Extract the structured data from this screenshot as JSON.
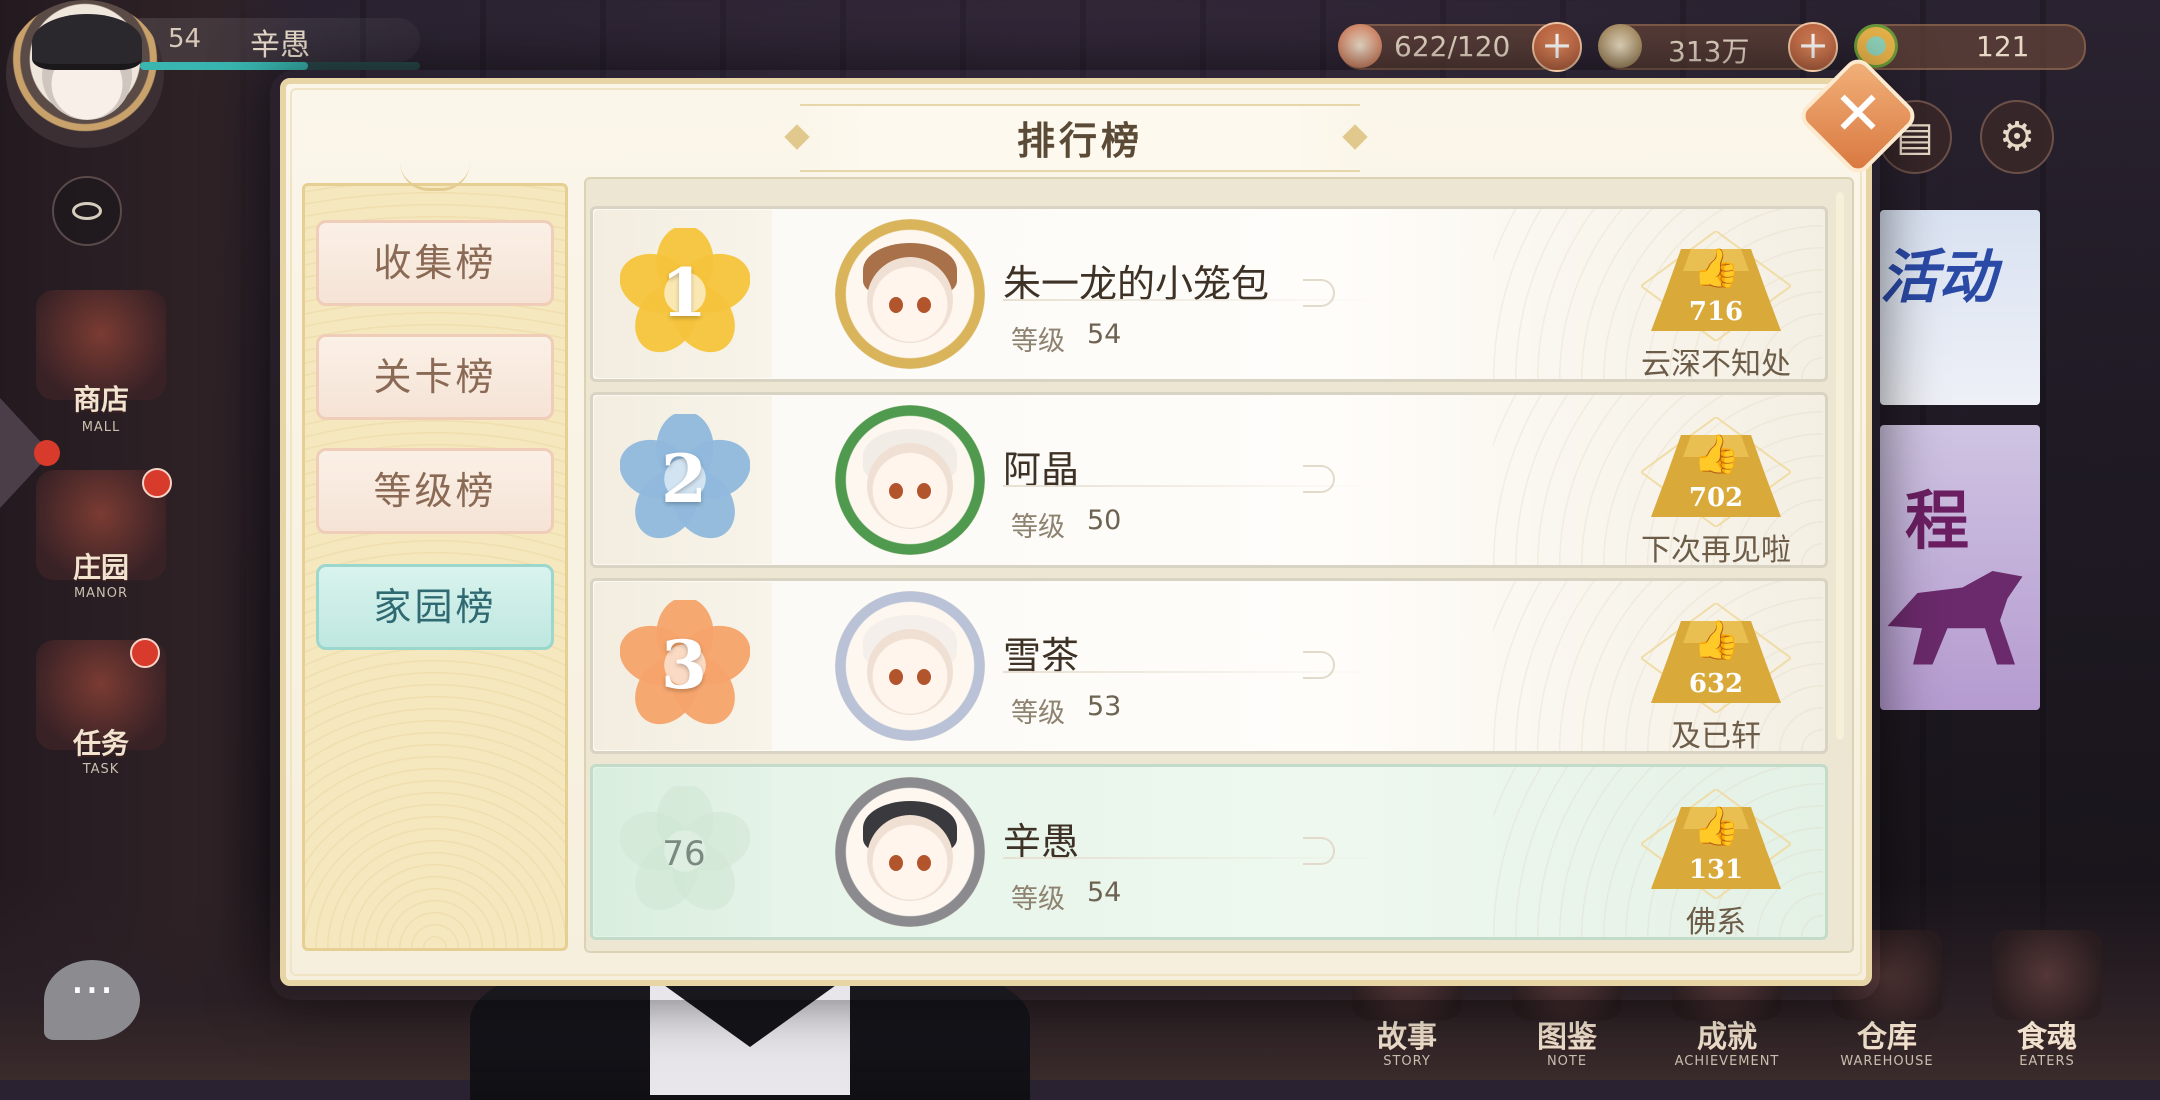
{
  "player": {
    "level": "54",
    "name": "辛愚",
    "exp_fraction": 0.6
  },
  "resources": [
    {
      "icon": "rice-bowl-icon",
      "value": "622/120",
      "has_plus": true
    },
    {
      "icon": "coin-icon",
      "value": "313万",
      "has_plus": true
    },
    {
      "icon": "jade-icon",
      "value": "121",
      "has_plus": false
    }
  ],
  "left_menu": [
    {
      "label": "商店",
      "sub": "MALL",
      "badge": false
    },
    {
      "label": "庄园",
      "sub": "MANOR",
      "badge": true
    },
    {
      "label": "任务",
      "sub": "TASK",
      "badge": true
    }
  ],
  "bottom_nav": [
    {
      "label": "故事",
      "sub": "STORY"
    },
    {
      "label": "图鉴",
      "sub": "NOTE"
    },
    {
      "label": "成就",
      "sub": "ACHIEVEMENT"
    },
    {
      "label": "仓库",
      "sub": "WAREHOUSE"
    },
    {
      "label": "食魂",
      "sub": "EATERS"
    }
  ],
  "background": {
    "banner_text_1": "活动",
    "banner_text_2": "程"
  },
  "modal": {
    "title": "排行榜",
    "close_label": "✕",
    "tabs": [
      {
        "label": "收集榜",
        "active": false
      },
      {
        "label": "关卡榜",
        "active": false
      },
      {
        "label": "等级榜",
        "active": false
      },
      {
        "label": "家园榜",
        "active": true
      }
    ],
    "level_label": "等级",
    "rows": [
      {
        "rank": "1",
        "name": "朱一龙的小笼包",
        "level": "54",
        "likes": "716",
        "guild": "云深不知处",
        "medal": "gold",
        "self": false
      },
      {
        "rank": "2",
        "name": "阿晶",
        "level": "50",
        "likes": "702",
        "guild": "下次再见啦",
        "medal": "blue",
        "self": false
      },
      {
        "rank": "3",
        "name": "雪茶",
        "level": "53",
        "likes": "632",
        "guild": "及已轩",
        "medal": "orange",
        "self": false
      },
      {
        "rank": "76",
        "name": "辛愚",
        "level": "54",
        "likes": "131",
        "guild": "佛系",
        "medal": "green",
        "self": true
      }
    ]
  },
  "colors": {
    "gold": "#f5c43c",
    "blue": "#8fb8dc",
    "orange": "#f6a36a",
    "green": "#cfe6d4",
    "like_badge": "#d9a93a"
  }
}
